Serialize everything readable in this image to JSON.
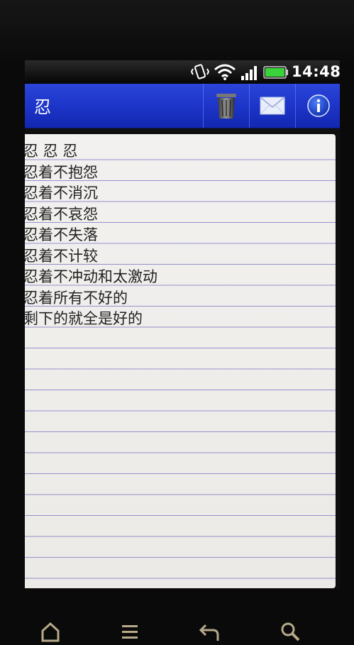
{
  "status_bar": {
    "time": "14:48",
    "icons": [
      "vibrate-icon",
      "wifi-icon",
      "signal-icon",
      "battery-icon"
    ]
  },
  "app": {
    "title": "忍",
    "actions": [
      "trash-icon",
      "mail-icon",
      "info-icon"
    ]
  },
  "note": {
    "lines": [
      "忍 忍 忍",
      "忍着不抱怨",
      "忍着不消沉",
      "忍着不哀怨",
      "忍着不失落",
      "忍着不计较",
      "忍着不冲动和太激动",
      "忍着所有不好的",
      "剩下的就全是好的"
    ]
  },
  "navigation": {
    "buttons": [
      "home-icon",
      "menu-icon",
      "back-icon",
      "search-icon"
    ]
  },
  "colors": {
    "title_bar": "#1c33c7",
    "paper": "#f0efec",
    "rule_line": "#8a86c9",
    "battery": "#3ad43a"
  }
}
